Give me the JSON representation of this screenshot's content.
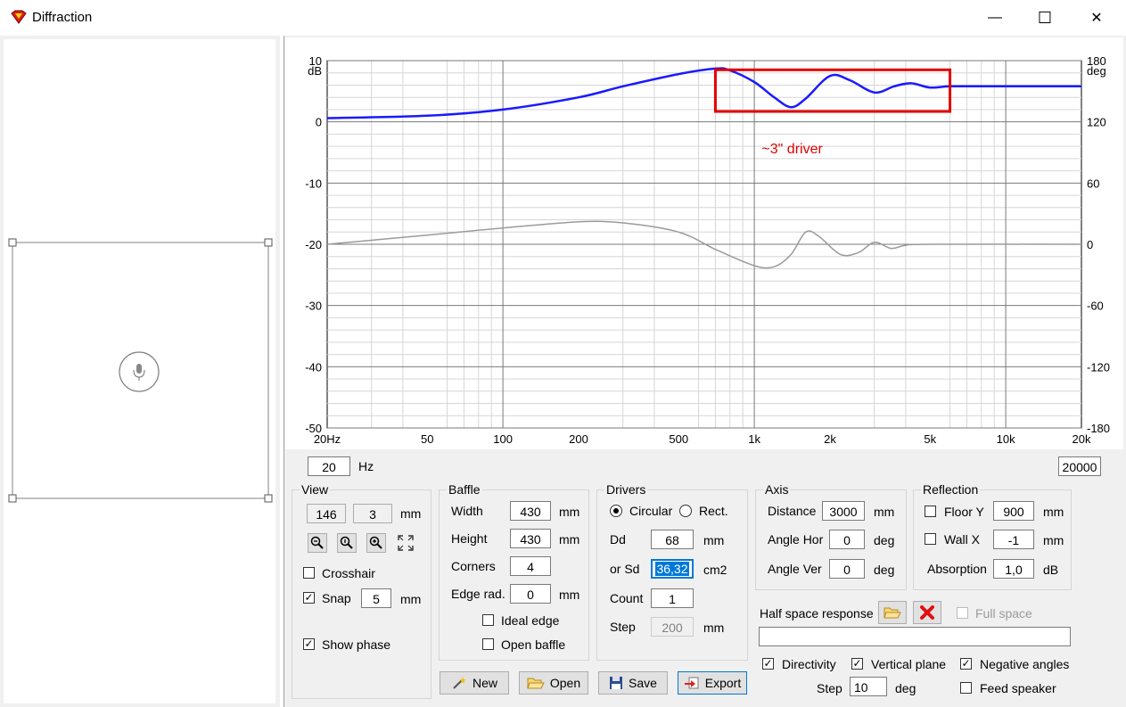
{
  "window": {
    "title": "Diffraction",
    "minimize_glyph": "—",
    "maximize_glyph": "☐",
    "close_glyph": "✕"
  },
  "chart_data": {
    "type": "line",
    "x_scale": "log",
    "xlim": [
      20,
      20000
    ],
    "x_ticks": [
      20,
      50,
      100,
      200,
      500,
      1000,
      2000,
      5000,
      10000,
      20000
    ],
    "x_tick_labels": [
      "20Hz",
      "50",
      "100",
      "200",
      "500",
      "1k",
      "2k",
      "5k",
      "10k",
      "20k"
    ],
    "ylim": [
      -50,
      10
    ],
    "y_ticks": [
      10,
      0,
      -10,
      -20,
      -30,
      -40,
      -50
    ],
    "y_tick_labels": [
      "10",
      "0",
      "-10",
      "-20",
      "-30",
      "-40",
      "-50"
    ],
    "y_unit_label": "dB",
    "y2lim": [
      -180,
      180
    ],
    "y2_ticks": [
      180,
      120,
      60,
      0,
      -60,
      -120,
      -180
    ],
    "y2_tick_labels": [
      "180",
      "120",
      "60",
      "0",
      "-60",
      "-120",
      "-180"
    ],
    "y2_unit_label": "deg",
    "grid": true,
    "series": [
      {
        "color": "#1a1aff",
        "axis": "left",
        "points": [
          [
            20,
            0.6
          ],
          [
            50,
            1.0
          ],
          [
            100,
            2.0
          ],
          [
            200,
            4.0
          ],
          [
            300,
            5.8
          ],
          [
            500,
            7.8
          ],
          [
            700,
            8.7
          ],
          [
            800,
            8.4
          ],
          [
            1000,
            6.5
          ],
          [
            1200,
            4.0
          ],
          [
            1400,
            2.4
          ],
          [
            1600,
            3.8
          ],
          [
            2000,
            7.5
          ],
          [
            2400,
            6.8
          ],
          [
            3000,
            4.8
          ],
          [
            3600,
            5.8
          ],
          [
            4200,
            6.3
          ],
          [
            5000,
            5.6
          ],
          [
            6000,
            5.8
          ],
          [
            8000,
            5.8
          ],
          [
            10000,
            5.8
          ],
          [
            20000,
            5.8
          ]
        ]
      },
      {
        "color": "#9a9a9a",
        "axis": "right",
        "points": [
          [
            20,
            0
          ],
          [
            50,
            9
          ],
          [
            100,
            16
          ],
          [
            200,
            22
          ],
          [
            300,
            21
          ],
          [
            500,
            12
          ],
          [
            700,
            -5
          ],
          [
            1000,
            -21
          ],
          [
            1200,
            -22
          ],
          [
            1400,
            -10
          ],
          [
            1600,
            12
          ],
          [
            1800,
            8
          ],
          [
            2200,
            -10
          ],
          [
            2600,
            -8
          ],
          [
            3000,
            2
          ],
          [
            3500,
            -4
          ],
          [
            4000,
            -1
          ],
          [
            5000,
            0
          ],
          [
            20000,
            0
          ]
        ]
      }
    ],
    "annotation": {
      "text": "~3\" driver",
      "color": "#e00000",
      "x_range": [
        700,
        6000
      ],
      "y_range": [
        1.7,
        8.5
      ]
    }
  },
  "freq": {
    "min": "20",
    "unit": "Hz",
    "max": "20000"
  },
  "view": {
    "title": "View",
    "x": "146",
    "y": "3",
    "unit": "mm",
    "crosshair_label": "Crosshair",
    "crosshair_checked": false,
    "snap_label": "Snap",
    "snap_checked": true,
    "snap_value": "5",
    "snap_unit": "mm",
    "show_phase_label": "Show phase",
    "show_phase_checked": true
  },
  "baffle": {
    "title": "Baffle",
    "width_label": "Width",
    "width": "430",
    "width_unit": "mm",
    "height_label": "Height",
    "height": "430",
    "height_unit": "mm",
    "corners_label": "Corners",
    "corners": "4",
    "edge_label": "Edge rad.",
    "edge": "0",
    "edge_unit": "mm",
    "ideal_edge_label": "Ideal edge",
    "ideal_edge_checked": false,
    "open_baffle_label": "Open baffle",
    "open_baffle_checked": false
  },
  "drivers": {
    "title": "Drivers",
    "circular_label": "Circular",
    "rect_label": "Rect.",
    "selected": "circular",
    "dd_label": "Dd",
    "dd": "68",
    "dd_unit": "mm",
    "sd_label": "or Sd",
    "sd": "36,32",
    "sd_unit": "cm2",
    "count_label": "Count",
    "count": "1",
    "step_label": "Step",
    "step": "200",
    "step_unit": "mm"
  },
  "axis": {
    "title": "Axis",
    "distance_label": "Distance",
    "distance": "3000",
    "distance_unit": "mm",
    "hor_label": "Angle Hor",
    "hor": "0",
    "hor_unit": "deg",
    "ver_label": "Angle Ver",
    "ver": "0",
    "ver_unit": "deg"
  },
  "reflection": {
    "title": "Reflection",
    "floor_label": "Floor Y",
    "floor": "900",
    "floor_unit": "mm",
    "floor_checked": false,
    "wall_label": "Wall  X",
    "wall": "-1",
    "wall_unit": "mm",
    "wall_checked": false,
    "absorption_label": "Absorption",
    "absorption": "1,0",
    "absorption_unit": "dB"
  },
  "halfspace": {
    "label": "Half space response",
    "full_space_label": "Full space",
    "full_space_checked": false,
    "path": ""
  },
  "options": {
    "directivity_label": "Directivity",
    "directivity_checked": true,
    "vertical_label": "Vertical plane",
    "vertical_checked": true,
    "negative_label": "Negative angles",
    "negative_checked": true,
    "step_label": "Step",
    "step": "10",
    "step_unit": "deg",
    "feed_label": "Feed speaker",
    "feed_checked": false
  },
  "buttons": {
    "new": "New",
    "open": "Open",
    "save": "Save",
    "export": "Export"
  }
}
